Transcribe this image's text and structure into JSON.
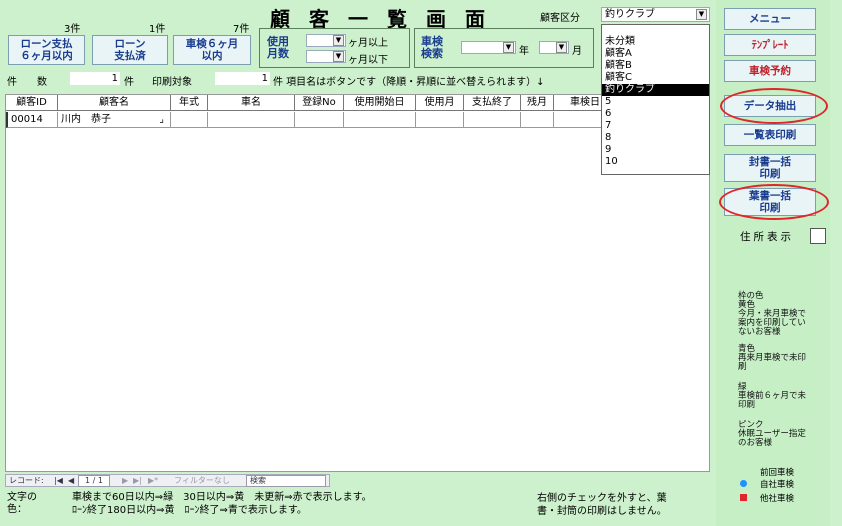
{
  "header": {
    "title": "顧客一覧画面",
    "counts": [
      "3件",
      "1件",
      "7件"
    ],
    "category_label": "顧客区分",
    "category_value": "釣りクラブ"
  },
  "buttons": {
    "loan6": "ローン支払\n６ヶ月以内",
    "loanpaid": "ローン\n支払済",
    "shaken6": "車検６ヶ月\n以内"
  },
  "filters": {
    "usage_label": "使用\n月数",
    "month_over": "ヶ月以上",
    "month_under": "ヶ月以下",
    "shaken_label": "車検\n検索",
    "year": "年",
    "month": "月"
  },
  "infobar": {
    "count_label": "件　　数",
    "count_value": "1",
    "count_unit": "件",
    "print_label": "印刷対象",
    "print_value": "1",
    "print_note": "件 項目名はボタンです（降順・昇順に並べ替えられます）↓"
  },
  "table": {
    "columns": [
      "顧客ID",
      "顧客名",
      "年式",
      "車名",
      "登録No",
      "使用開始日",
      "使用月",
      "支払終了",
      "残月",
      "車検日"
    ],
    "rows": [
      [
        "00014",
        "川内　恭子",
        "",
        "",
        "",
        "",
        "",
        "",
        "",
        ""
      ]
    ]
  },
  "dropdown": {
    "options": [
      "未分類",
      "顧客A",
      "顧客B",
      "顧客C",
      "釣りクラブ",
      "5",
      "6",
      "7",
      "8",
      "9",
      "10"
    ],
    "selected": "釣りクラブ"
  },
  "nav": {
    "record_label": "レコード:",
    "position": "1 / 1",
    "filter": "フィルターなし",
    "search": "検索"
  },
  "footer": {
    "label": "文字の\n色：",
    "line1": "車検まで60日以内⇒緑　30日以内⇒黄　未更新⇒赤で表示します。",
    "line2": "ﾛｰﾝ終了180日以内⇒黄　ﾛｰﾝ終了⇒青で表示します。",
    "right": "右側のチェックを外すと、葉\n書・封筒の印刷はしません。"
  },
  "sidebar": {
    "menu": "メニュー",
    "template": "ﾃﾝﾌﾟﾚｰﾄ",
    "reservation": "車検予約",
    "extract": "データ抽出",
    "list_print": "一覧表印刷",
    "envelope": "封書一括\n印刷",
    "postcard": "葉書一括\n印刷",
    "address": "住所表示",
    "notes": [
      "枠の色\n黄色\n今月・来月車検で\n案内を印刷してい\nないお客様",
      "青色\n再来月車検で未印\n刷",
      "緑\n車検前６ヶ月で未\n印刷",
      "ピンク\n休眠ユーザー指定\nのお客様"
    ],
    "legend_title": "前回車検",
    "legend_own": "自社車検",
    "legend_other": "他社車検",
    "legend_own_color": "#1e90ff",
    "legend_other_color": "#e0252b"
  }
}
